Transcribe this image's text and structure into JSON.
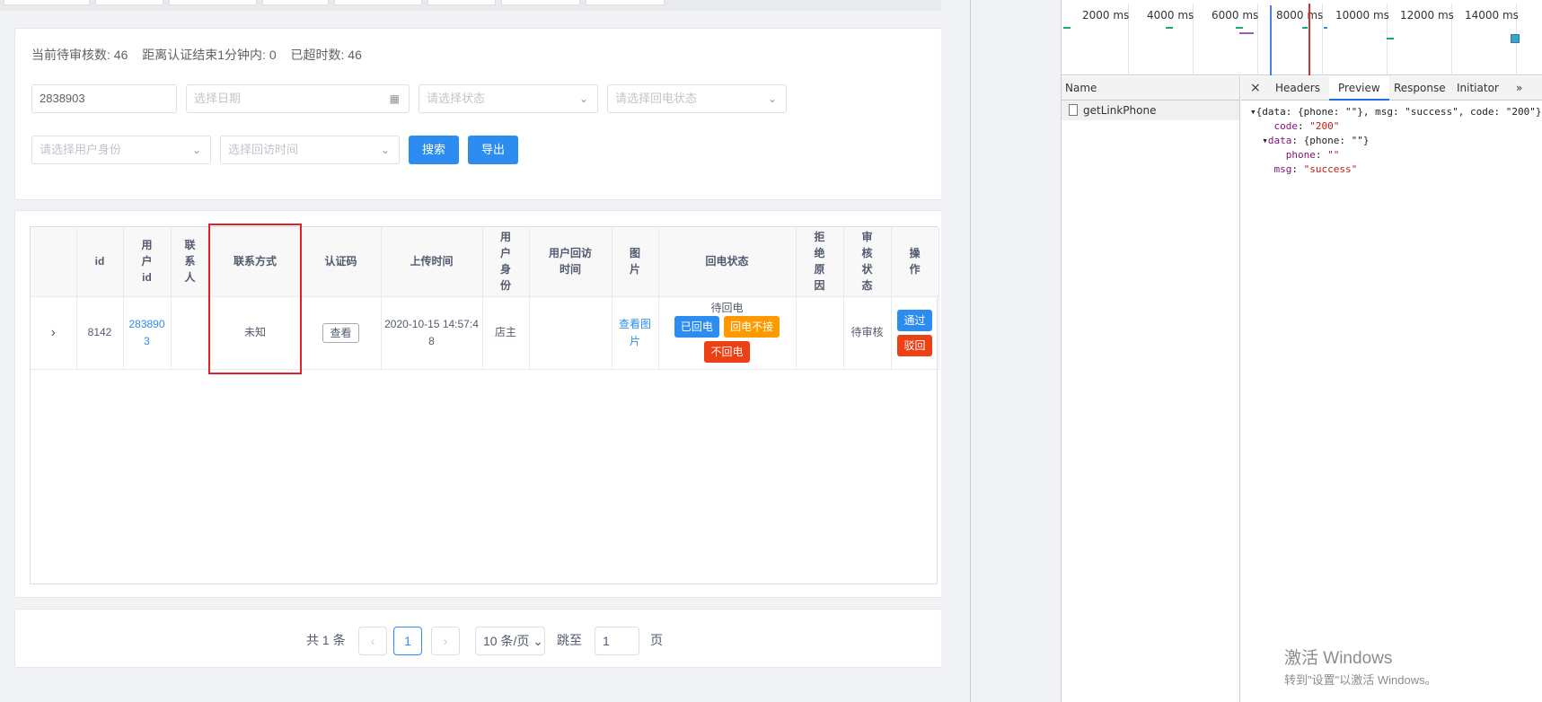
{
  "summary": {
    "pending": "当前待审核数: 46",
    "within_minute": "距离认证结束1分钟内: 0",
    "overdue": "已超时数: 46"
  },
  "filters": {
    "id_value": "2838903",
    "date_placeholder": "选择日期",
    "status_placeholder": "请选择状态",
    "callback_status_placeholder": "请选择回电状态",
    "identity_placeholder": "请选择用户身份",
    "visit_time_placeholder": "选择回访时间",
    "search_label": "搜索",
    "export_label": "导出"
  },
  "table": {
    "headers": [
      "",
      "id",
      "用户id",
      "联系人",
      "联系方式",
      "认证码",
      "上传时间",
      "用户身份",
      "用户回访时间",
      "图片",
      "回电状态",
      "拒绝原因",
      "审核状态",
      "操作"
    ],
    "row": {
      "expand": "›",
      "id": "8142",
      "user_id": "2838903",
      "contact_name": "",
      "contact_method": "未知",
      "auth_code_btn": "查看",
      "upload_time": "2020-10-15 14:57:48",
      "identity": "店主",
      "visit_time": "",
      "image_link": "查看图片",
      "callback_status": "待回电",
      "btn_called": "已回电",
      "btn_no_answer": "回电不接",
      "btn_not_called": "不回电",
      "reject_reason": "",
      "audit_status": "待审核",
      "btn_pass": "通过",
      "btn_reject": "驳回"
    }
  },
  "pager": {
    "total": "共 1 条",
    "current": "1",
    "page_size": "10 条/页",
    "jump_label": "跳至",
    "jump_value": "1",
    "page_suffix": "页"
  },
  "devtools": {
    "ticks": [
      "2000 ms",
      "4000 ms",
      "6000 ms",
      "8000 ms",
      "10000 ms",
      "12000 ms",
      "14000 ms"
    ],
    "name_header": "Name",
    "request_name": "getLinkPhone",
    "tabs": [
      "Headers",
      "Preview",
      "Response",
      "Initiator"
    ],
    "active_tab": "Preview",
    "json_line1": "{data: {phone: \"\"}, msg: \"success\", code: \"200\"}",
    "code_key": "code",
    "code_val": "\"200\"",
    "data_key": "data",
    "data_val": "{phone: \"\"}",
    "phone_key": "phone",
    "phone_val": "\"\"",
    "msg_key": "msg",
    "msg_val": "\"success\""
  },
  "watermark": {
    "line1": "激活 Windows",
    "line2": "转到\"设置\"以激活 Windows。"
  },
  "colors": {
    "primary": "#2d8cf0",
    "warning": "#ff9900",
    "danger": "#ed4014",
    "highlight": "#e4202b"
  }
}
